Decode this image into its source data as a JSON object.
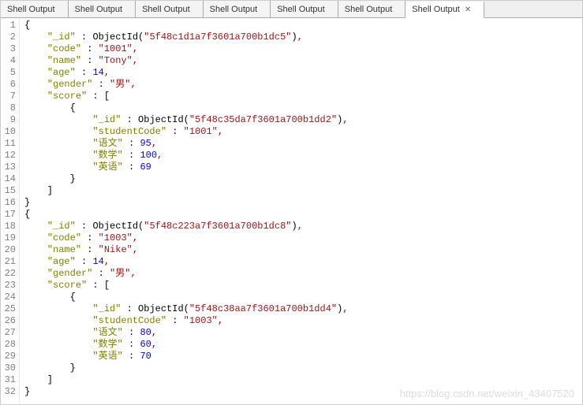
{
  "tabs": [
    {
      "label": "Shell Output",
      "active": false
    },
    {
      "label": "Shell Output",
      "active": false
    },
    {
      "label": "Shell Output",
      "active": false
    },
    {
      "label": "Shell Output",
      "active": false
    },
    {
      "label": "Shell Output",
      "active": false
    },
    {
      "label": "Shell Output",
      "active": false
    },
    {
      "label": "Shell Output",
      "active": true
    }
  ],
  "close_icon": "✕",
  "lines": [
    {
      "n": "1",
      "tokens": [
        {
          "t": "{",
          "c": "p"
        }
      ]
    },
    {
      "n": "2",
      "tokens": [
        {
          "t": "    ",
          "c": "p"
        },
        {
          "t": "\"_id\"",
          "c": "k"
        },
        {
          "t": " : ",
          "c": "p"
        },
        {
          "t": "ObjectId",
          "c": "f"
        },
        {
          "t": "(",
          "c": "p"
        },
        {
          "t": "\"5f48c1d1a7f3601a700b1dc5\"",
          "c": "s"
        },
        {
          "t": ")",
          "c": "p"
        },
        {
          "t": ",",
          "c": "pc"
        }
      ]
    },
    {
      "n": "3",
      "tokens": [
        {
          "t": "    ",
          "c": "p"
        },
        {
          "t": "\"code\"",
          "c": "k"
        },
        {
          "t": " : ",
          "c": "p"
        },
        {
          "t": "\"1001\"",
          "c": "s"
        },
        {
          "t": ",",
          "c": "pc"
        }
      ]
    },
    {
      "n": "4",
      "tokens": [
        {
          "t": "    ",
          "c": "p"
        },
        {
          "t": "\"name\"",
          "c": "k"
        },
        {
          "t": " : ",
          "c": "p"
        },
        {
          "t": "\"Tony\"",
          "c": "s"
        },
        {
          "t": ",",
          "c": "pc"
        }
      ]
    },
    {
      "n": "5",
      "tokens": [
        {
          "t": "    ",
          "c": "p"
        },
        {
          "t": "\"age\"",
          "c": "k"
        },
        {
          "t": " : ",
          "c": "p"
        },
        {
          "t": "14",
          "c": "n"
        },
        {
          "t": ",",
          "c": "pc"
        }
      ]
    },
    {
      "n": "6",
      "tokens": [
        {
          "t": "    ",
          "c": "p"
        },
        {
          "t": "\"gender\"",
          "c": "k"
        },
        {
          "t": " : ",
          "c": "p"
        },
        {
          "t": "\"男\"",
          "c": "s"
        },
        {
          "t": ",",
          "c": "pc"
        }
      ]
    },
    {
      "n": "7",
      "tokens": [
        {
          "t": "    ",
          "c": "p"
        },
        {
          "t": "\"score\"",
          "c": "k"
        },
        {
          "t": " : [",
          "c": "p"
        }
      ]
    },
    {
      "n": "8",
      "tokens": [
        {
          "t": "        {",
          "c": "p"
        }
      ]
    },
    {
      "n": "9",
      "tokens": [
        {
          "t": "            ",
          "c": "p"
        },
        {
          "t": "\"_id\"",
          "c": "k"
        },
        {
          "t": " : ",
          "c": "p"
        },
        {
          "t": "ObjectId",
          "c": "f"
        },
        {
          "t": "(",
          "c": "p"
        },
        {
          "t": "\"5f48c35da7f3601a700b1dd2\"",
          "c": "s"
        },
        {
          "t": ")",
          "c": "p"
        },
        {
          "t": ",",
          "c": "pc"
        }
      ]
    },
    {
      "n": "10",
      "tokens": [
        {
          "t": "            ",
          "c": "p"
        },
        {
          "t": "\"studentCode\"",
          "c": "k"
        },
        {
          "t": " : ",
          "c": "p"
        },
        {
          "t": "\"1001\"",
          "c": "s"
        },
        {
          "t": ",",
          "c": "pc"
        }
      ]
    },
    {
      "n": "11",
      "tokens": [
        {
          "t": "            ",
          "c": "p"
        },
        {
          "t": "\"语文\"",
          "c": "k"
        },
        {
          "t": " : ",
          "c": "p"
        },
        {
          "t": "95",
          "c": "n"
        },
        {
          "t": ",",
          "c": "pc"
        }
      ]
    },
    {
      "n": "12",
      "tokens": [
        {
          "t": "            ",
          "c": "p"
        },
        {
          "t": "\"数学\"",
          "c": "k"
        },
        {
          "t": " : ",
          "c": "p"
        },
        {
          "t": "100",
          "c": "n"
        },
        {
          "t": ",",
          "c": "pc"
        }
      ]
    },
    {
      "n": "13",
      "tokens": [
        {
          "t": "            ",
          "c": "p"
        },
        {
          "t": "\"英语\"",
          "c": "k"
        },
        {
          "t": " : ",
          "c": "p"
        },
        {
          "t": "69",
          "c": "n"
        }
      ]
    },
    {
      "n": "14",
      "tokens": [
        {
          "t": "        }",
          "c": "p"
        }
      ]
    },
    {
      "n": "15",
      "tokens": [
        {
          "t": "    ]",
          "c": "p"
        }
      ]
    },
    {
      "n": "16",
      "tokens": [
        {
          "t": "}",
          "c": "p"
        }
      ]
    },
    {
      "n": "17",
      "tokens": [
        {
          "t": "{",
          "c": "p"
        }
      ]
    },
    {
      "n": "18",
      "tokens": [
        {
          "t": "    ",
          "c": "p"
        },
        {
          "t": "\"_id\"",
          "c": "k"
        },
        {
          "t": " : ",
          "c": "p"
        },
        {
          "t": "ObjectId",
          "c": "f"
        },
        {
          "t": "(",
          "c": "p"
        },
        {
          "t": "\"5f48c223a7f3601a700b1dc8\"",
          "c": "s"
        },
        {
          "t": ")",
          "c": "p"
        },
        {
          "t": ",",
          "c": "pc"
        }
      ]
    },
    {
      "n": "19",
      "tokens": [
        {
          "t": "    ",
          "c": "p"
        },
        {
          "t": "\"code\"",
          "c": "k"
        },
        {
          "t": " : ",
          "c": "p"
        },
        {
          "t": "\"1003\"",
          "c": "s"
        },
        {
          "t": ",",
          "c": "pc"
        }
      ]
    },
    {
      "n": "20",
      "tokens": [
        {
          "t": "    ",
          "c": "p"
        },
        {
          "t": "\"name\"",
          "c": "k"
        },
        {
          "t": " : ",
          "c": "p"
        },
        {
          "t": "\"Nike\"",
          "c": "s"
        },
        {
          "t": ",",
          "c": "pc"
        }
      ]
    },
    {
      "n": "21",
      "tokens": [
        {
          "t": "    ",
          "c": "p"
        },
        {
          "t": "\"age\"",
          "c": "k"
        },
        {
          "t": " : ",
          "c": "p"
        },
        {
          "t": "14",
          "c": "n"
        },
        {
          "t": ",",
          "c": "pc"
        }
      ]
    },
    {
      "n": "22",
      "tokens": [
        {
          "t": "    ",
          "c": "p"
        },
        {
          "t": "\"gender\"",
          "c": "k"
        },
        {
          "t": " : ",
          "c": "p"
        },
        {
          "t": "\"男\"",
          "c": "s"
        },
        {
          "t": ",",
          "c": "pc"
        }
      ]
    },
    {
      "n": "23",
      "tokens": [
        {
          "t": "    ",
          "c": "p"
        },
        {
          "t": "\"score\"",
          "c": "k"
        },
        {
          "t": " : [",
          "c": "p"
        }
      ]
    },
    {
      "n": "24",
      "tokens": [
        {
          "t": "        {",
          "c": "p"
        }
      ]
    },
    {
      "n": "25",
      "tokens": [
        {
          "t": "            ",
          "c": "p"
        },
        {
          "t": "\"_id\"",
          "c": "k"
        },
        {
          "t": " : ",
          "c": "p"
        },
        {
          "t": "ObjectId",
          "c": "f"
        },
        {
          "t": "(",
          "c": "p"
        },
        {
          "t": "\"5f48c38aa7f3601a700b1dd4\"",
          "c": "s"
        },
        {
          "t": ")",
          "c": "p"
        },
        {
          "t": ",",
          "c": "pc"
        }
      ]
    },
    {
      "n": "26",
      "tokens": [
        {
          "t": "            ",
          "c": "p"
        },
        {
          "t": "\"studentCode\"",
          "c": "k"
        },
        {
          "t": " : ",
          "c": "p"
        },
        {
          "t": "\"1003\"",
          "c": "s"
        },
        {
          "t": ",",
          "c": "pc"
        }
      ]
    },
    {
      "n": "27",
      "tokens": [
        {
          "t": "            ",
          "c": "p"
        },
        {
          "t": "\"语文\"",
          "c": "k"
        },
        {
          "t": " : ",
          "c": "p"
        },
        {
          "t": "80",
          "c": "n"
        },
        {
          "t": ",",
          "c": "pc"
        }
      ]
    },
    {
      "n": "28",
      "tokens": [
        {
          "t": "            ",
          "c": "p"
        },
        {
          "t": "\"数学\"",
          "c": "k"
        },
        {
          "t": " : ",
          "c": "p"
        },
        {
          "t": "60",
          "c": "n"
        },
        {
          "t": ",",
          "c": "pc"
        }
      ]
    },
    {
      "n": "29",
      "tokens": [
        {
          "t": "            ",
          "c": "p"
        },
        {
          "t": "\"英语\"",
          "c": "k"
        },
        {
          "t": " : ",
          "c": "p"
        },
        {
          "t": "70",
          "c": "n"
        }
      ]
    },
    {
      "n": "30",
      "tokens": [
        {
          "t": "        }",
          "c": "p"
        }
      ]
    },
    {
      "n": "31",
      "tokens": [
        {
          "t": "    ]",
          "c": "p"
        }
      ]
    },
    {
      "n": "32",
      "tokens": [
        {
          "t": "}",
          "c": "p"
        }
      ]
    }
  ],
  "watermark": "https://blog.csdn.net/weixin_43407520"
}
